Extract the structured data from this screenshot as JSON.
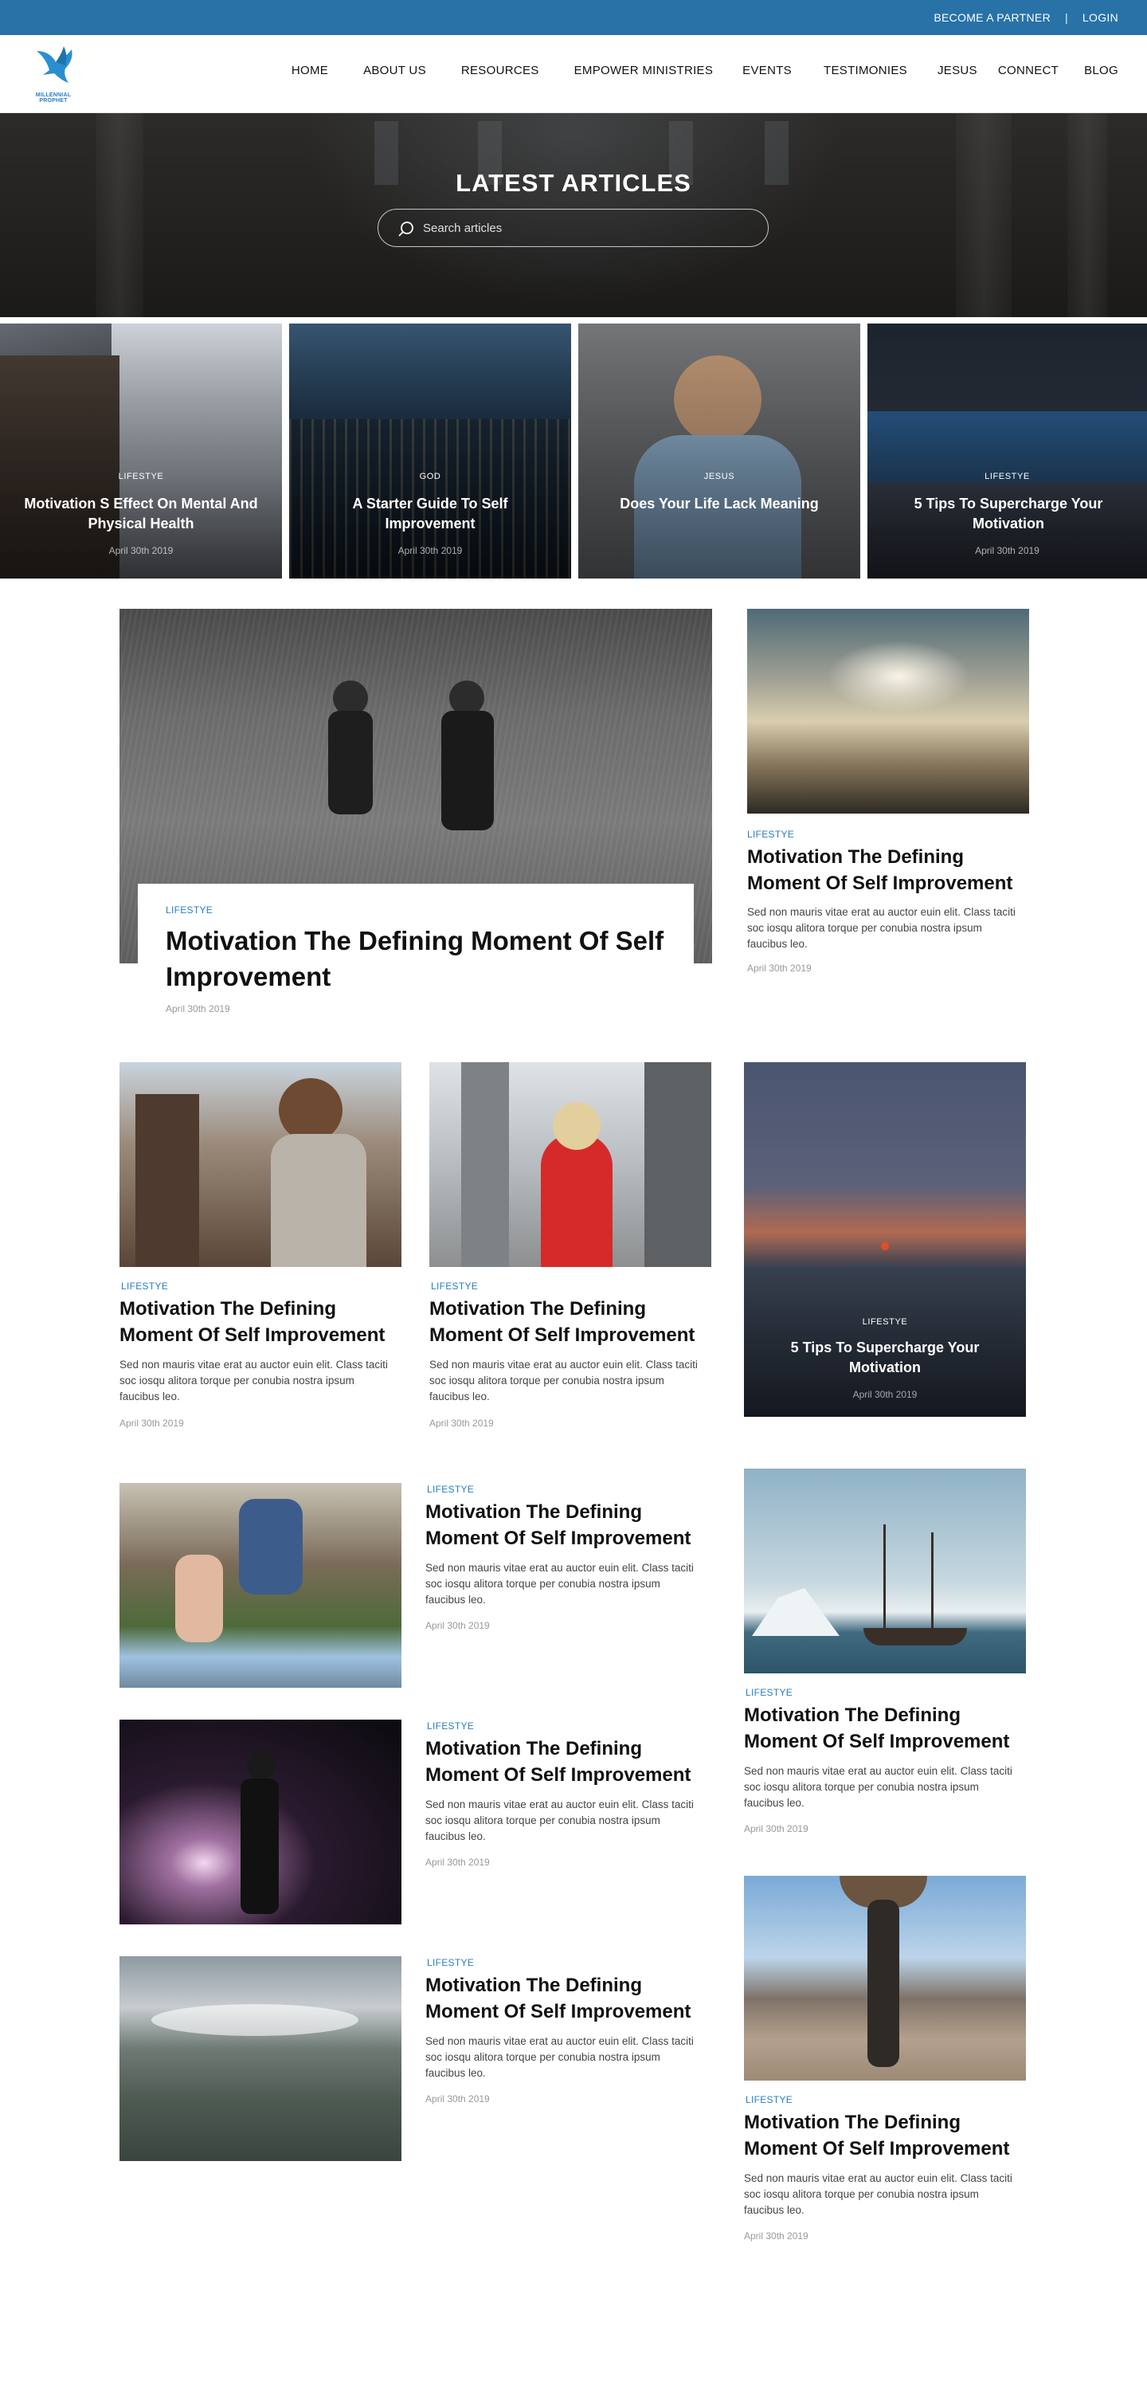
{
  "topbar": {
    "partner": "BECOME A PARTNER",
    "separator": "|",
    "login": "LOGIN"
  },
  "logo": {
    "text": "MILLENNIAL PROPHET"
  },
  "nav": [
    {
      "label": "HOME"
    },
    {
      "label": "ABOUT US"
    },
    {
      "label": "RESOURCES"
    },
    {
      "label": "EMPOWER MINISTRIES"
    },
    {
      "label": "EVENTS"
    },
    {
      "label": "TESTIMONIES"
    },
    {
      "label": "JESUS"
    },
    {
      "label": "CONNECT"
    },
    {
      "label": "BLOG"
    }
  ],
  "hero": {
    "title": "LATEST ARTICLES",
    "search_placeholder": "Search articles"
  },
  "featured": [
    {
      "category": "LIFESTYE",
      "title": "Motivation S Effect On Mental And Physical Health",
      "date": "April 30th 2019"
    },
    {
      "category": "GOD",
      "title": "A Starter Guide To Self Improvement",
      "date": "April 30th 2019"
    },
    {
      "category": "JESUS",
      "title": "Does Your Life Lack Meaning",
      "date": ""
    },
    {
      "category": "LIFESTYE",
      "title": "5 Tips To Supercharge Your Motivation",
      "date": "April 30th 2019"
    }
  ],
  "main_article": {
    "category": "LIFESTYE",
    "title": "Motivation The Defining Moment Of Self Improvement",
    "date": "April 30th 2019"
  },
  "articles": [
    {
      "category": "LIFESTYE",
      "title": "Motivation The Defining Moment Of Self Improvement",
      "excerpt": "Sed non mauris vitae erat au auctor euin elit. Class taciti soc iosqu alitora torque per conubia nostra ipsum faucibus leo.",
      "date": "April 30th 2019"
    },
    {
      "category": "LIFESTYE",
      "title": "Motivation The Defining Moment Of Self Improvement",
      "excerpt": "Sed non mauris vitae erat au auctor euin elit. Class taciti soc iosqu alitora torque per conubia nostra ipsum faucibus leo.",
      "date": "April 30th 2019"
    },
    {
      "category": "LIFESTYE",
      "title": "Motivation The Defining Moment Of Self Improvement",
      "excerpt": "Sed non mauris vitae erat au auctor euin elit. Class taciti soc iosqu alitora torque per conubia nostra ipsum faucibus leo.",
      "date": "April 30th 2019"
    },
    {
      "category": "LIFESTYE",
      "title": "Motivation The Defining Moment Of Self Improvement",
      "excerpt": "Sed non mauris vitae erat au auctor euin elit. Class taciti soc iosqu alitora torque per conubia nostra ipsum faucibus leo.",
      "date": "April 30th 2019"
    },
    {
      "category": "LIFESTYE",
      "title": "Motivation The Defining Moment Of Self Improvement",
      "excerpt": "Sed non mauris vitae erat au auctor euin elit. Class taciti soc iosqu alitora torque per conubia nostra ipsum faucibus leo.",
      "date": "April 30th 2019"
    },
    {
      "category": "LIFESTYE",
      "title": "Motivation The Defining Moment Of Self Improvement",
      "excerpt": "Sed non mauris vitae erat au auctor euin elit. Class taciti soc iosqu alitora torque per conubia nostra ipsum faucibus leo.",
      "date": "April 30th 2019"
    },
    {
      "category": "LIFESTYE",
      "title": "Motivation The Defining Moment Of Self Improvement",
      "excerpt": "Sed non mauris vitae erat au auctor euin elit. Class taciti soc iosqu alitora torque per conubia nostra ipsum faucibus leo.",
      "date": "April 30th 2019"
    },
    {
      "category": "LIFESTYE",
      "title": "Motivation The Defining Moment Of Self Improvement",
      "excerpt": "Sed non mauris vitae erat au auctor euin elit. Class taciti soc iosqu alitora torque per conubia nostra ipsum faucibus leo.",
      "date": "April 30th 2019"
    }
  ],
  "sunset_card": {
    "category": "LIFESTYE",
    "title": "5 Tips To Supercharge Your Motivation",
    "date": "April 30th 2019"
  },
  "colors": {
    "brand_blue": "#2872a8",
    "category_blue": "#2a7fbc",
    "text": "#111111",
    "muted": "#999999"
  }
}
